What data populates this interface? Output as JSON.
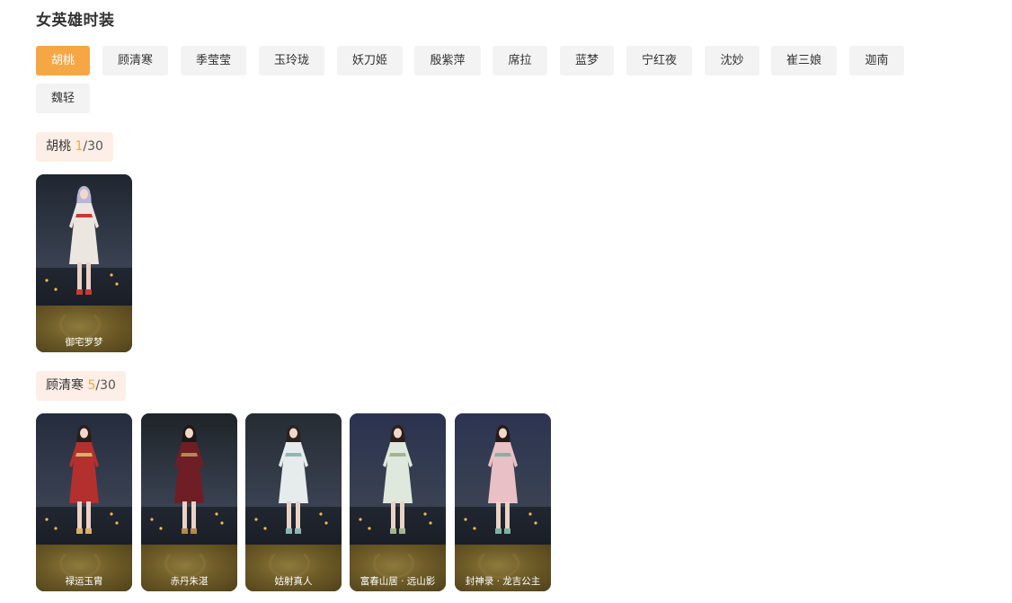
{
  "page": {
    "title": "女英雄时装"
  },
  "tabs": [
    "胡桃",
    "顾清寒",
    "季莹莹",
    "玉玲珑",
    "妖刀姬",
    "殷紫萍",
    "席拉",
    "蓝梦",
    "宁红夜",
    "沈妙",
    "崔三娘",
    "迦南",
    "魏轻"
  ],
  "active_tab": "胡桃",
  "sections": [
    {
      "hero": "胡桃",
      "owned": "1",
      "total": "/30",
      "skins": [
        {
          "name": "御宅罗梦",
          "hair": "#b9b6d6",
          "outfit": "#ece6e0",
          "accent": "#c93a32",
          "bg": "#1f2630"
        }
      ]
    },
    {
      "hero": "顾清寒",
      "owned": "5",
      "total": "/30",
      "skins": [
        {
          "name": "禄运玉胄",
          "hair": "#2a1d1a",
          "outfit": "#b3302e",
          "accent": "#d9b066",
          "bg": "#242c3e"
        },
        {
          "name": "赤丹朱湛",
          "hair": "#1e1716",
          "outfit": "#6f1e26",
          "accent": "#b48a4a",
          "bg": "#1e2428"
        },
        {
          "name": "姑射真人",
          "hair": "#2a2320",
          "outfit": "#e6ecec",
          "accent": "#8fb6b5",
          "bg": "#252c33"
        },
        {
          "name": "富春山居 · 远山影",
          "hair": "#2a1f1c",
          "outfit": "#dfe8dd",
          "accent": "#a3b48e",
          "bg": "#2b3250"
        },
        {
          "name": "封神录 · 龙吉公主",
          "hair": "#261b19",
          "outfit": "#e9c0c5",
          "accent": "#7fb3a4",
          "bg": "#2c3452"
        }
      ]
    }
  ]
}
